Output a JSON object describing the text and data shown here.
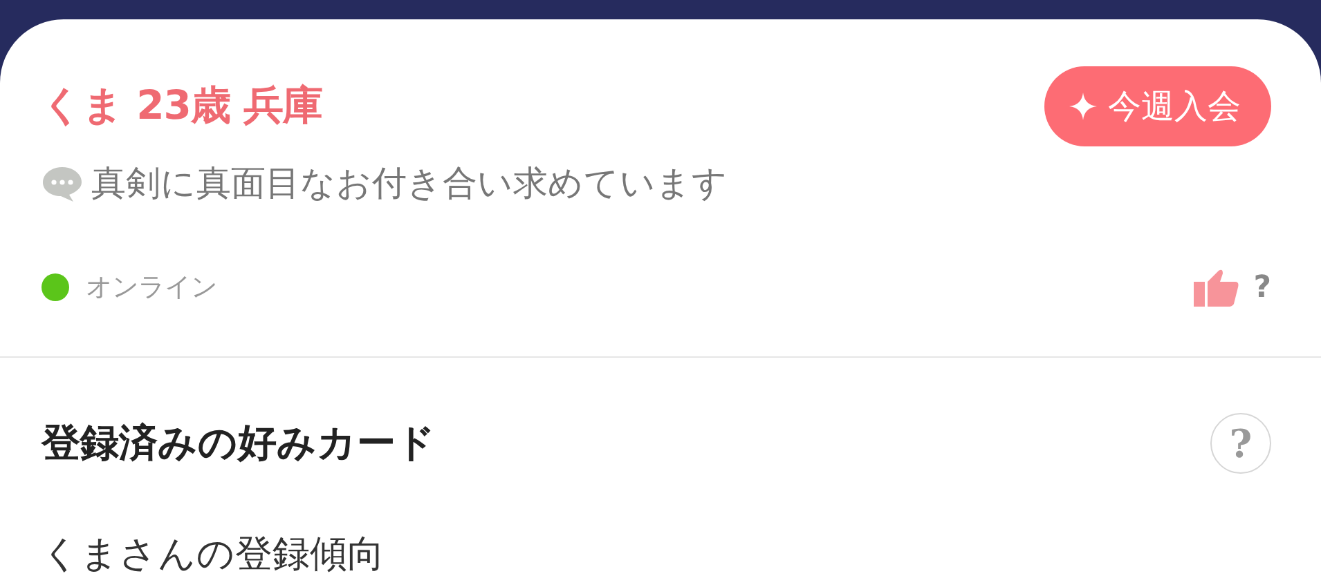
{
  "profile": {
    "heading": "くま 23歳 兵庫",
    "badge": "今週入会",
    "message": "真剣に真面目なお付き合い求めています",
    "status": {
      "label": "オンライン",
      "online": true
    },
    "like_mark": "?"
  },
  "preferences": {
    "title": "登録済みの好みカード",
    "help": "?",
    "subtitle": "くまさんの登録傾向"
  }
}
